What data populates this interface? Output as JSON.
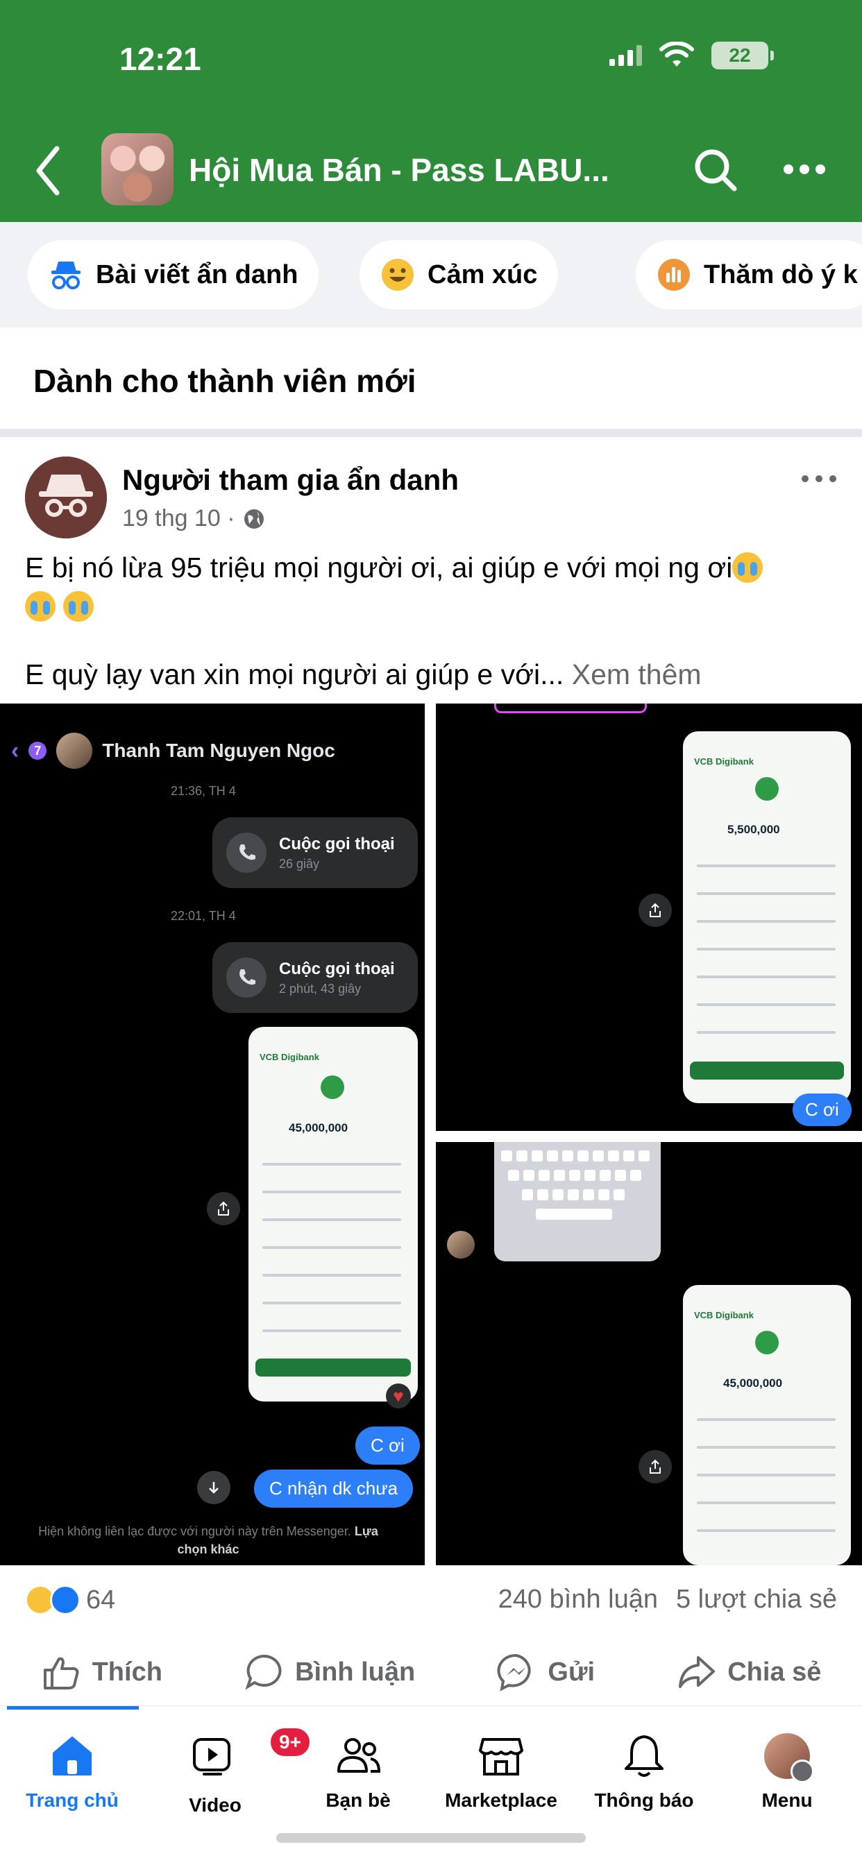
{
  "status_bar": {
    "time": "12:21",
    "battery": "22"
  },
  "header": {
    "title": "Hội Mua Bán - Pass LABU..."
  },
  "chips": [
    {
      "label": "Bài viết ẩn danh",
      "icon": "anonymous-icon"
    },
    {
      "label": "Cảm xúc",
      "icon": "smiley-icon"
    },
    {
      "label": "Thăm dò ý k",
      "icon": "poll-icon"
    }
  ],
  "section": {
    "title": "Dành cho thành viên mới"
  },
  "post": {
    "author": "Người tham gia ẩn danh",
    "date": "19 thg 10 ·",
    "text_line1": "E bị nó lừa 95 triệu mọi người ơi, ai giúp e với mọi ng ơi",
    "text_line2": "E quỳ lạy van xin mọi người ai giúp e với...",
    "see_more": "Xem thêm"
  },
  "media": {
    "chat_contact": "Thanh Tam Nguyen Ngoc",
    "badge": "7",
    "time1": "21:36, TH 4",
    "call1_title": "Cuộc gọi thoại",
    "call1_sub": "26 giây",
    "time2": "22:01, TH 4",
    "call2_title": "Cuộc gọi thoại",
    "call2_sub": "2 phút, 43 giây",
    "receipt_bank": "VCB Digibank",
    "receipt_amount_1": "45,000,000",
    "receipt_amount_2": "5,500,000",
    "receipt_amount_3": "45,000,000",
    "bubble_c_oi_1": "C ơi",
    "bubble_c_nhan": "C nhận dk chưa",
    "bubble_c_oi_2": "C ơi",
    "footer_note": "Hiện không liên lạc được với người này trên Messenger.",
    "footer_link": "Lựa chọn khác"
  },
  "engagement": {
    "reactions": "64",
    "comments": "240 bình luận",
    "shares": "5 lượt chia sẻ"
  },
  "actions": {
    "like": "Thích",
    "comment": "Bình luận",
    "send": "Gửi",
    "share": "Chia sẻ"
  },
  "tabs": [
    {
      "label": "Trang chủ",
      "icon": "home-icon"
    },
    {
      "label": "Video",
      "icon": "video-icon",
      "badge": "9+"
    },
    {
      "label": "Bạn bè",
      "icon": "friends-icon"
    },
    {
      "label": "Marketplace",
      "icon": "marketplace-icon"
    },
    {
      "label": "Thông báo",
      "icon": "bell-icon"
    },
    {
      "label": "Menu",
      "icon": "menu-avatar-icon"
    }
  ],
  "colors": {
    "header_bg": "#2e8b3a",
    "accent": "#1877f2",
    "secondary_text": "#65676b"
  }
}
